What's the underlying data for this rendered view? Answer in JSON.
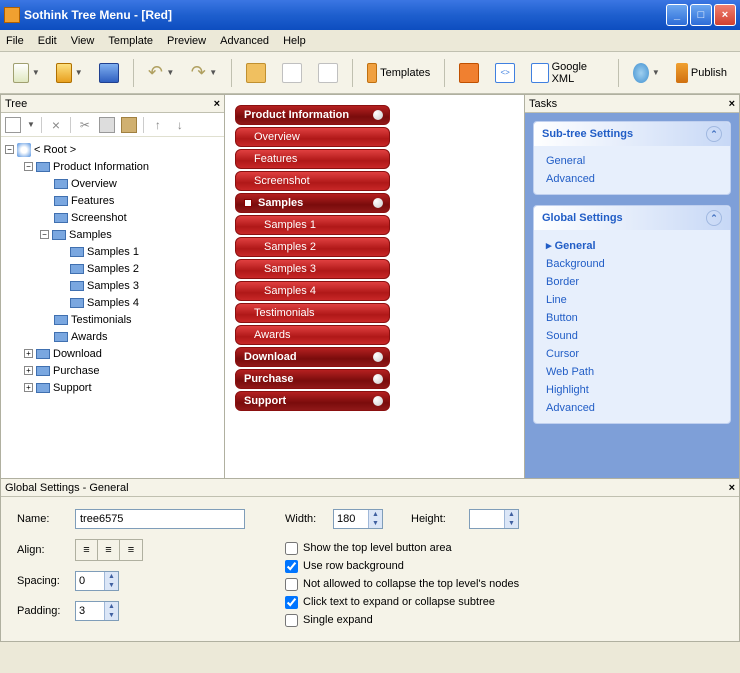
{
  "title": "Sothink Tree Menu - [Red]",
  "menubar": [
    "File",
    "Edit",
    "View",
    "Template",
    "Preview",
    "Advanced",
    "Help"
  ],
  "toolbar": {
    "templates_label": "Templates",
    "google_xml_label": "Google XML",
    "publish_label": "Publish"
  },
  "tree_panel": {
    "title": "Tree",
    "root": "< Root >",
    "nodes": [
      {
        "label": "Product Information",
        "depth": 1,
        "expander": "-"
      },
      {
        "label": "Overview",
        "depth": 2
      },
      {
        "label": "Features",
        "depth": 2
      },
      {
        "label": "Screenshot",
        "depth": 2
      },
      {
        "label": "Samples",
        "depth": 2,
        "expander": "-"
      },
      {
        "label": "Samples 1",
        "depth": 3
      },
      {
        "label": "Samples 2",
        "depth": 3
      },
      {
        "label": "Samples 3",
        "depth": 3
      },
      {
        "label": "Samples 4",
        "depth": 3
      },
      {
        "label": "Testimonials",
        "depth": 2
      },
      {
        "label": "Awards",
        "depth": 2
      },
      {
        "label": "Download",
        "depth": 1,
        "expander": "+"
      },
      {
        "label": "Purchase",
        "depth": 1,
        "expander": "+"
      },
      {
        "label": "Support",
        "depth": 1,
        "expander": "+"
      }
    ]
  },
  "preview": {
    "items": [
      {
        "label": "Product Information",
        "class": "dark",
        "bullet": true
      },
      {
        "label": "Overview",
        "class": "sub"
      },
      {
        "label": "Features",
        "class": "sub"
      },
      {
        "label": "Screenshot",
        "class": "sub"
      },
      {
        "label": "Samples",
        "class": "dark",
        "bullet": true,
        "sq": true
      },
      {
        "label": "Samples 1",
        "class": "sub2"
      },
      {
        "label": "Samples 2",
        "class": "sub2"
      },
      {
        "label": "Samples 3",
        "class": "sub2"
      },
      {
        "label": "Samples 4",
        "class": "sub2"
      },
      {
        "label": "Testimonials",
        "class": "sub"
      },
      {
        "label": "Awards",
        "class": "sub"
      },
      {
        "label": "Download",
        "class": "dark",
        "bullet": true
      },
      {
        "label": "Purchase",
        "class": "dark",
        "bullet": true
      },
      {
        "label": "Support",
        "class": "dark",
        "bullet": true
      }
    ]
  },
  "tasks": {
    "title": "Tasks",
    "groups": [
      {
        "title": "Sub-tree Settings",
        "items": [
          {
            "label": "General"
          },
          {
            "label": "Advanced"
          }
        ]
      },
      {
        "title": "Global Settings",
        "items": [
          {
            "label": "General",
            "active": true
          },
          {
            "label": "Background"
          },
          {
            "label": "Border"
          },
          {
            "label": "Line"
          },
          {
            "label": "Button"
          },
          {
            "label": "Sound"
          },
          {
            "label": "Cursor"
          },
          {
            "label": "Web Path"
          },
          {
            "label": "Highlight"
          },
          {
            "label": "Advanced"
          }
        ]
      }
    ]
  },
  "settings": {
    "title": "Global Settings - General",
    "name_label": "Name:",
    "name_value": "tree6575",
    "align_label": "Align:",
    "spacing_label": "Spacing:",
    "spacing_value": "0",
    "padding_label": "Padding:",
    "padding_value": "3",
    "width_label": "Width:",
    "width_value": "180",
    "height_label": "Height:",
    "height_value": "",
    "checks": [
      {
        "label": "Show the top level button area",
        "checked": false
      },
      {
        "label": "Use row background",
        "checked": true
      },
      {
        "label": "Not allowed to collapse the top level's nodes",
        "checked": false
      },
      {
        "label": "Click text to expand or collapse subtree",
        "checked": true
      },
      {
        "label": "Single expand",
        "checked": false
      }
    ]
  }
}
